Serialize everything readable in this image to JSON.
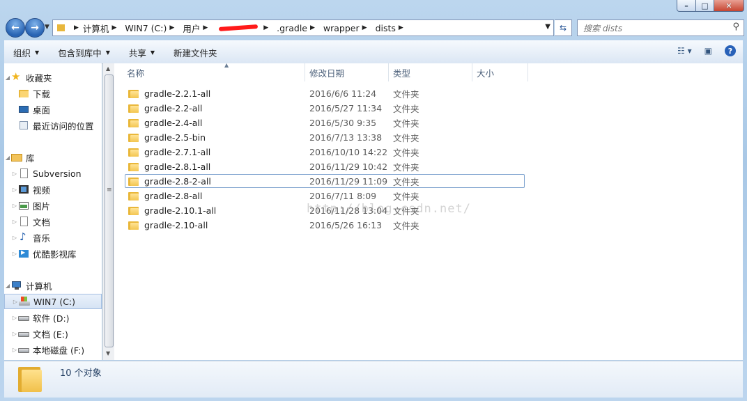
{
  "window": {
    "controls": [
      "minimize",
      "maximize",
      "close"
    ]
  },
  "address_bar": {
    "breadcrumbs": [
      "计算机",
      "WIN7 (C:)",
      "用户",
      "",
      ".gradle",
      "wrapper",
      "dists"
    ],
    "redacted_crumb_index": 3
  },
  "search": {
    "placeholder": "搜索 dists"
  },
  "toolbar": {
    "organize": "组织",
    "include_in_library": "包含到库中",
    "share": "共享",
    "new_folder": "新建文件夹"
  },
  "nav_pane": {
    "favorites": {
      "label": "收藏夹",
      "items": [
        "下载",
        "桌面",
        "最近访问的位置"
      ]
    },
    "libraries": {
      "label": "库",
      "items": [
        "Subversion",
        "视频",
        "图片",
        "文档",
        "音乐",
        "优酷影视库"
      ]
    },
    "computer": {
      "label": "计算机",
      "items": [
        "WIN7 (C:)",
        "软件 (D:)",
        "文档 (E:)",
        "本地磁盘 (F:)"
      ],
      "selected": "WIN7 (C:)"
    }
  },
  "columns": [
    "名称",
    "修改日期",
    "类型",
    "大小"
  ],
  "files": [
    {
      "name": "gradle-2.2.1-all",
      "date": "2016/6/6 11:24",
      "type": "文件夹",
      "size": ""
    },
    {
      "name": "gradle-2.2-all",
      "date": "2016/5/27 11:34",
      "type": "文件夹",
      "size": ""
    },
    {
      "name": "gradle-2.4-all",
      "date": "2016/5/30 9:35",
      "type": "文件夹",
      "size": ""
    },
    {
      "name": "gradle-2.5-bin",
      "date": "2016/7/13 13:38",
      "type": "文件夹",
      "size": ""
    },
    {
      "name": "gradle-2.7.1-all",
      "date": "2016/10/10 14:22",
      "type": "文件夹",
      "size": ""
    },
    {
      "name": "gradle-2.8.1-all",
      "date": "2016/11/29 10:42",
      "type": "文件夹",
      "size": ""
    },
    {
      "name": "gradle-2.8-2-all",
      "date": "2016/11/29 11:09",
      "type": "文件夹",
      "size": ""
    },
    {
      "name": "gradle-2.8-all",
      "date": "2016/7/11 8:09",
      "type": "文件夹",
      "size": ""
    },
    {
      "name": "gradle-2.10.1-all",
      "date": "2016/11/28 13:04",
      "type": "文件夹",
      "size": ""
    },
    {
      "name": "gradle-2.10-all",
      "date": "2016/5/26 16:13",
      "type": "文件夹",
      "size": ""
    }
  ],
  "focused_file_index": 6,
  "status": {
    "item_count": "10 个对象"
  },
  "watermark": "http://blog.csdn.net/"
}
